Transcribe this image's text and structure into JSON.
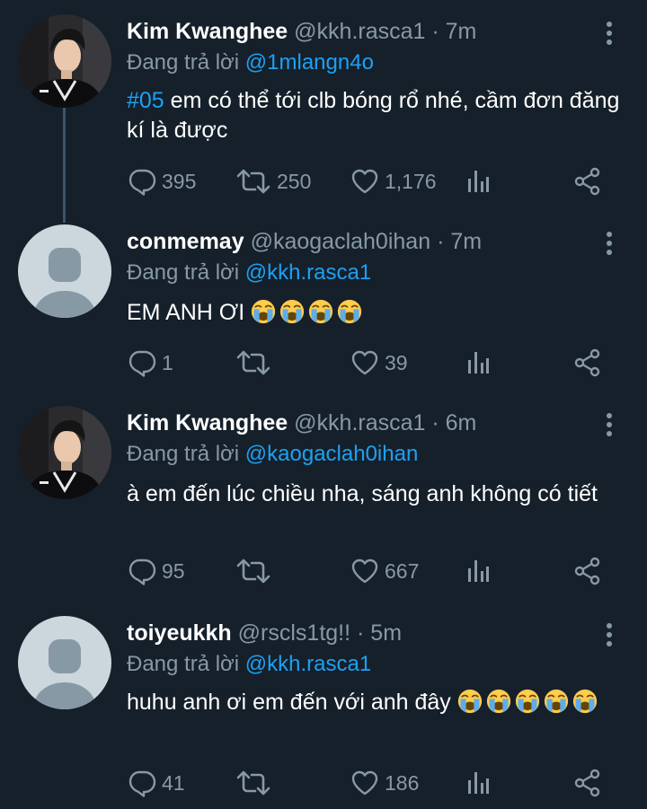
{
  "reply_prefix": "Đang trả lời",
  "tweets": [
    {
      "name": "Kim Kwanghee",
      "handle": "@kkh.rasca1",
      "time": "7m",
      "reply_to": "@1mlangn4o",
      "hashtag": "#05",
      "text": "em có thể tới clb bóng rổ nhé, cầm đơn đăng kí là được",
      "counts": {
        "replies": "395",
        "retweets": "250",
        "likes": "1,176"
      }
    },
    {
      "name": "conmemay",
      "handle": "@kaogaclah0ihan",
      "time": "7m",
      "reply_to": "@kkh.rasca1",
      "text": "EM ANH ƠI",
      "emoji": "loudly-crying-face",
      "emoji_count": 4,
      "counts": {
        "replies": "1",
        "retweets": "",
        "likes": "39"
      }
    },
    {
      "name": "Kim Kwanghee",
      "handle": "@kkh.rasca1",
      "time": "6m",
      "reply_to": "@kaogaclah0ihan",
      "text": "à em đến lúc chiều nha, sáng anh không có tiết",
      "counts": {
        "replies": "95",
        "retweets": "",
        "likes": "667"
      }
    },
    {
      "name": "toiyeukkh",
      "handle": "@rscls1tg!!",
      "time": "5m",
      "reply_to": "@kkh.rasca1",
      "text": "huhu anh ơi em đến với anh đây",
      "emoji": "loudly-crying-face",
      "emoji_count": 5,
      "counts": {
        "replies": "41",
        "retweets": "",
        "likes": "186"
      }
    }
  ],
  "colors": {
    "background": "#15202b",
    "accent": "#1da1f2",
    "secondary_text": "#8899a6",
    "thread_line": "#3d5466"
  },
  "icons": [
    "reply-icon",
    "retweet-icon",
    "like-icon",
    "analytics-icon",
    "share-icon",
    "more-icon",
    "loudly-crying-face"
  ]
}
